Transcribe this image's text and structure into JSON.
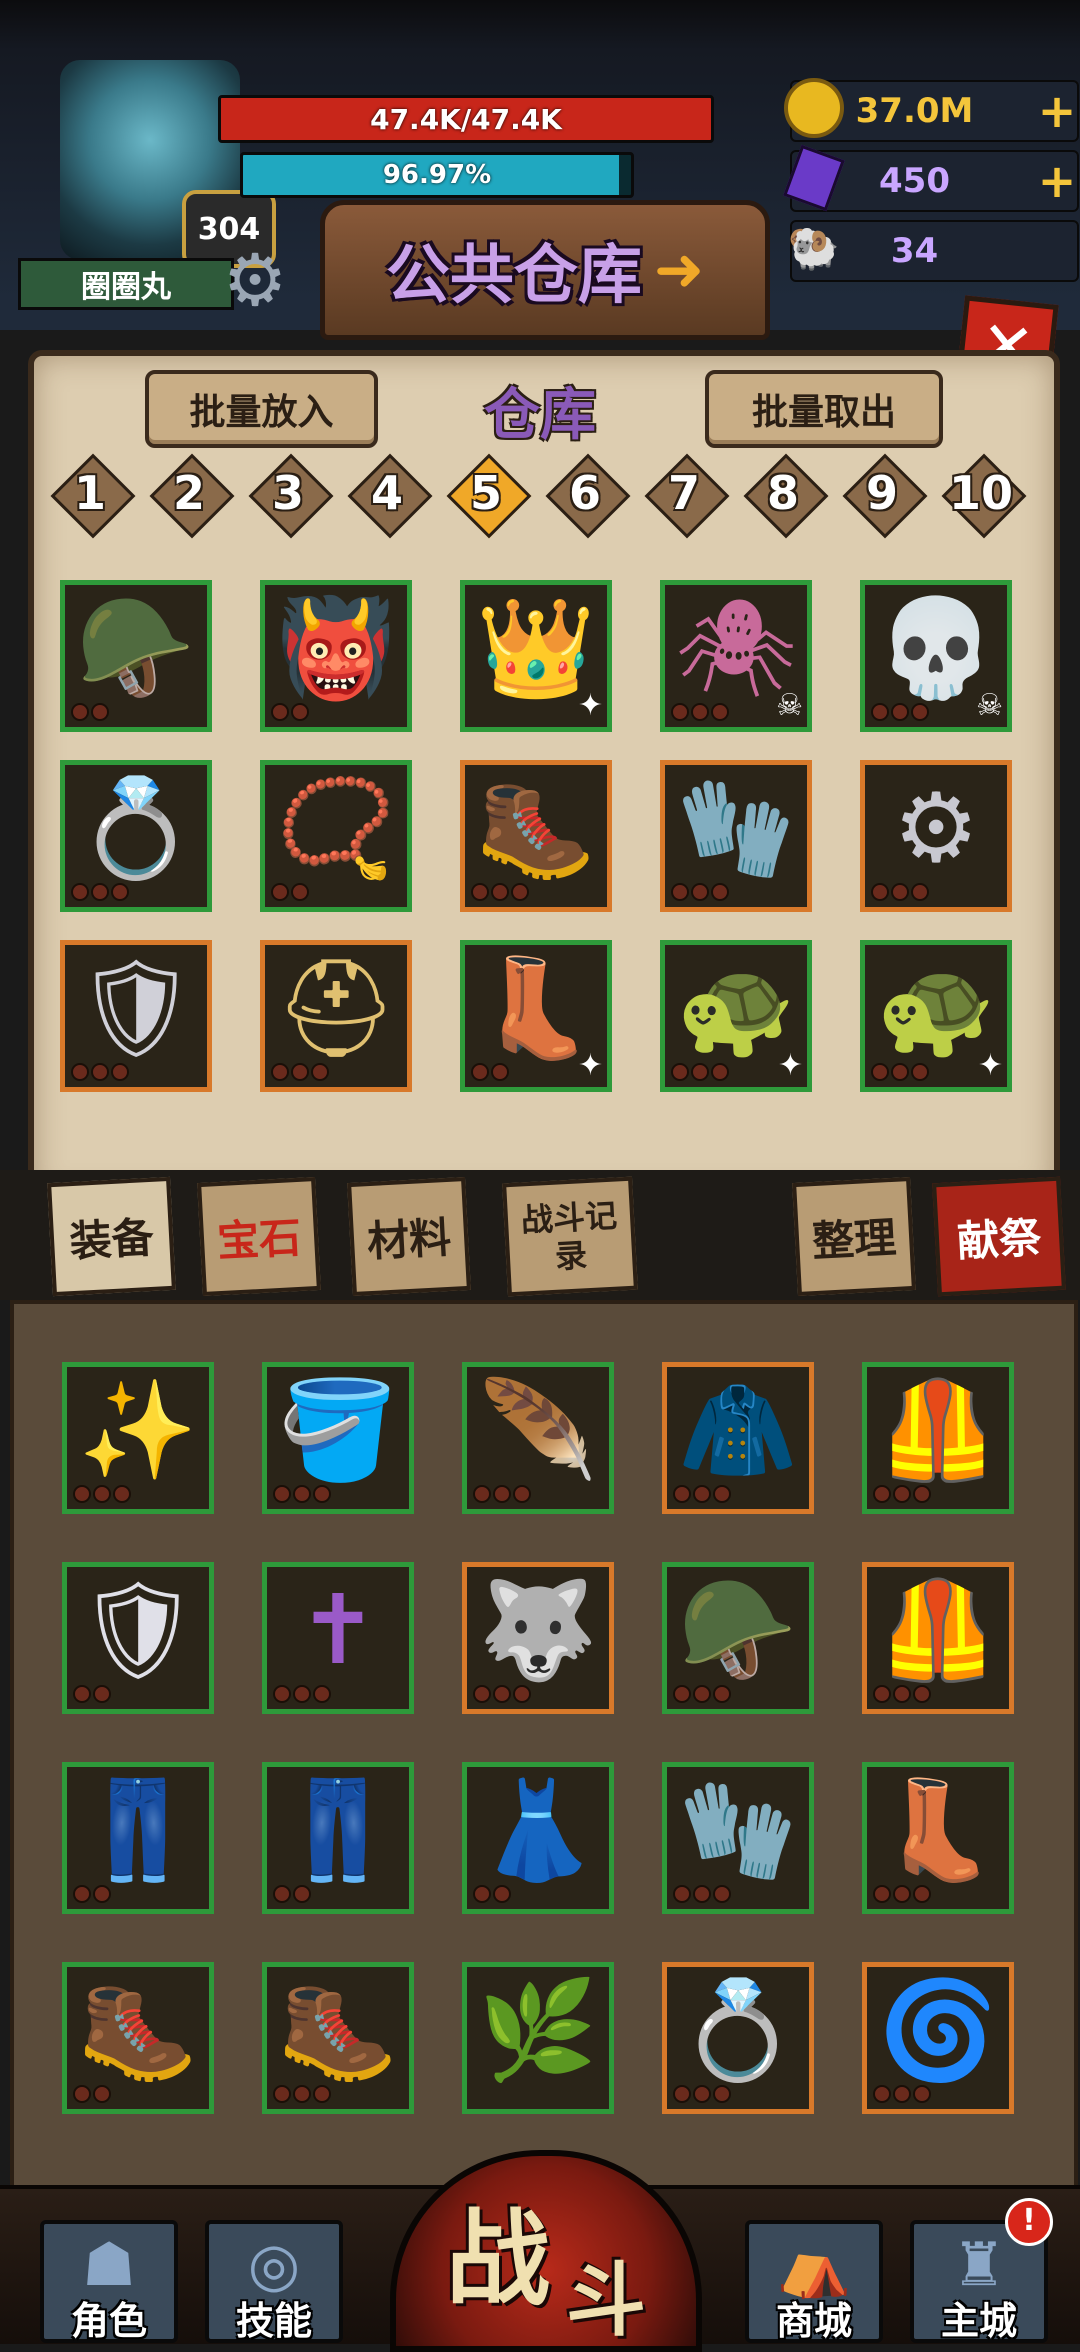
{
  "player": {
    "name": "圈圈丸",
    "level": "304",
    "hp_text": "47.4K/47.4K",
    "hp_fraction": 1.0,
    "exp_text": "96.97%",
    "exp_fraction": 0.9697
  },
  "currencies": [
    {
      "icon": "gold-coin-icon",
      "value": "37.0M",
      "plus": "+",
      "color": "#f4c53b"
    },
    {
      "icon": "purple-crystal-icon",
      "value": "450",
      "plus": "+",
      "color": "#c9a6ff"
    },
    {
      "icon": "ram-skull-icon",
      "value": "34",
      "plus": "",
      "color": "#c9a6ff"
    }
  ],
  "banner": {
    "title": "公共仓库"
  },
  "warehouse": {
    "title": "仓库",
    "batch_put": "批量放入",
    "batch_take": "批量取出",
    "pages": [
      "1",
      "2",
      "3",
      "4",
      "5",
      "6",
      "7",
      "8",
      "9",
      "10"
    ],
    "active_page": "5",
    "items": [
      {
        "name": "green-helmet",
        "border": "green",
        "glyph": "🪖",
        "color": "#7a9a52",
        "dots": 2,
        "mark": ""
      },
      {
        "name": "horned-fur-helmet",
        "border": "green",
        "glyph": "👹",
        "color": "#a8c07a",
        "dots": 2,
        "mark": ""
      },
      {
        "name": "red-horn-crown",
        "border": "green",
        "glyph": "👑",
        "color": "#8a2a22",
        "dots": 0,
        "mark": "✦"
      },
      {
        "name": "spider-amulet",
        "border": "green",
        "glyph": "🕷",
        "color": "#c86a9a",
        "dots": 3,
        "mark": "☠"
      },
      {
        "name": "bone-collar",
        "border": "green",
        "glyph": "💀",
        "color": "#d8c8b0",
        "dots": 3,
        "mark": "☠"
      },
      {
        "name": "eye-ring",
        "border": "green",
        "glyph": "💍",
        "color": "#c88a3a",
        "dots": 3,
        "mark": ""
      },
      {
        "name": "dark-necklace",
        "border": "green",
        "glyph": "📿",
        "color": "#3a2a1a",
        "dots": 2,
        "mark": ""
      },
      {
        "name": "plate-boots",
        "border": "orange",
        "glyph": "🥾",
        "color": "#c8c8d0",
        "dots": 3,
        "mark": ""
      },
      {
        "name": "red-gauntlets",
        "border": "orange",
        "glyph": "🧤",
        "color": "#c8c8d0",
        "dots": 3,
        "mark": ""
      },
      {
        "name": "silver-belt",
        "border": "orange",
        "glyph": "⚙",
        "color": "#c8c8d0",
        "dots": 3,
        "mark": ""
      },
      {
        "name": "silver-chest-armor",
        "border": "orange",
        "glyph": "🛡",
        "color": "#d0d0d8",
        "dots": 3,
        "mark": ""
      },
      {
        "name": "winged-helmet",
        "border": "orange",
        "glyph": "⛑",
        "color": "#e0c070",
        "dots": 3,
        "mark": ""
      },
      {
        "name": "gold-boots",
        "border": "green",
        "glyph": "👢",
        "color": "#c8902a",
        "dots": 2,
        "mark": "✦"
      },
      {
        "name": "turtle-shell",
        "border": "green",
        "glyph": "🐢",
        "color": "#b8d0a0",
        "dots": 3,
        "mark": "✦"
      },
      {
        "name": "turtle-shell-2",
        "border": "green",
        "glyph": "🐢",
        "color": "#b8d0a0",
        "dots": 3,
        "mark": "✦"
      }
    ]
  },
  "tabs": [
    {
      "name": "tab-equipment",
      "label": "装备"
    },
    {
      "name": "tab-gems",
      "label": "宝石"
    },
    {
      "name": "tab-materials",
      "label": "材料"
    },
    {
      "name": "tab-battle-log",
      "label": "战斗记录"
    },
    {
      "name": "tab-sort",
      "label": "整理"
    },
    {
      "name": "tab-sacrifice",
      "label": "献祭"
    }
  ],
  "inventory": {
    "items": [
      {
        "name": "gold-halo",
        "border": "green",
        "glyph": "✨",
        "color": "#e0b030",
        "dots": 3
      },
      {
        "name": "silver-tower-helm",
        "border": "green",
        "glyph": "🪣",
        "color": "#c8c8d0",
        "dots": 3
      },
      {
        "name": "feather-crown",
        "border": "green",
        "glyph": "🪶",
        "color": "#e8e0c8",
        "dots": 3
      },
      {
        "name": "hooded-armor",
        "border": "orange",
        "glyph": "🧥",
        "color": "#8a6a52",
        "dots": 3
      },
      {
        "name": "leather-armor",
        "border": "green",
        "glyph": "🦺",
        "color": "#7a4a3a",
        "dots": 3
      },
      {
        "name": "white-plate-armor",
        "border": "green",
        "glyph": "🛡",
        "color": "#e0e0e8",
        "dots": 2
      },
      {
        "name": "purple-cross-armor",
        "border": "green",
        "glyph": "✝",
        "color": "#9a5ac8",
        "dots": 3
      },
      {
        "name": "dark-beast-armor",
        "border": "orange",
        "glyph": "🐺",
        "color": "#5a3a2a",
        "dots": 3
      },
      {
        "name": "green-helmet-2",
        "border": "green",
        "glyph": "🪖",
        "color": "#7a9a52",
        "dots": 3
      },
      {
        "name": "rogue-armor",
        "border": "orange",
        "glyph": "🦺",
        "color": "#6a3a2a",
        "dots": 3
      },
      {
        "name": "yellow-pants",
        "border": "green",
        "glyph": "👖",
        "color": "#e8c030",
        "dots": 2
      },
      {
        "name": "purple-pants",
        "border": "green",
        "glyph": "👖",
        "color": "#5a2a4a",
        "dots": 2
      },
      {
        "name": "red-skirt",
        "border": "green",
        "glyph": "👗",
        "color": "#8a2a1a",
        "dots": 2
      },
      {
        "name": "red-gauntlets-2",
        "border": "green",
        "glyph": "🧤",
        "color": "#c8c8d0",
        "dots": 3
      },
      {
        "name": "cream-boots",
        "border": "green",
        "glyph": "👢",
        "color": "#e8d8b0",
        "dots": 3
      },
      {
        "name": "leather-boots",
        "border": "green",
        "glyph": "🥾",
        "color": "#6a4a2a",
        "dots": 2
      },
      {
        "name": "steel-boots",
        "border": "green",
        "glyph": "🥾",
        "color": "#c8c8d0",
        "dots": 3
      },
      {
        "name": "vine-necklace",
        "border": "green",
        "glyph": "🌿",
        "color": "#c8d0c0",
        "dots": 0
      },
      {
        "name": "serpent-ring",
        "border": "orange",
        "glyph": "💍",
        "color": "#c8a040",
        "dots": 3
      },
      {
        "name": "gold-coil-ring",
        "border": "orange",
        "glyph": "🌀",
        "color": "#d8b030",
        "dots": 3
      }
    ]
  },
  "nav": {
    "character": "角色",
    "skills": "技能",
    "battle_1": "战",
    "battle_2": "斗",
    "shop": "商城",
    "main_city": "主城",
    "alert": "!"
  }
}
